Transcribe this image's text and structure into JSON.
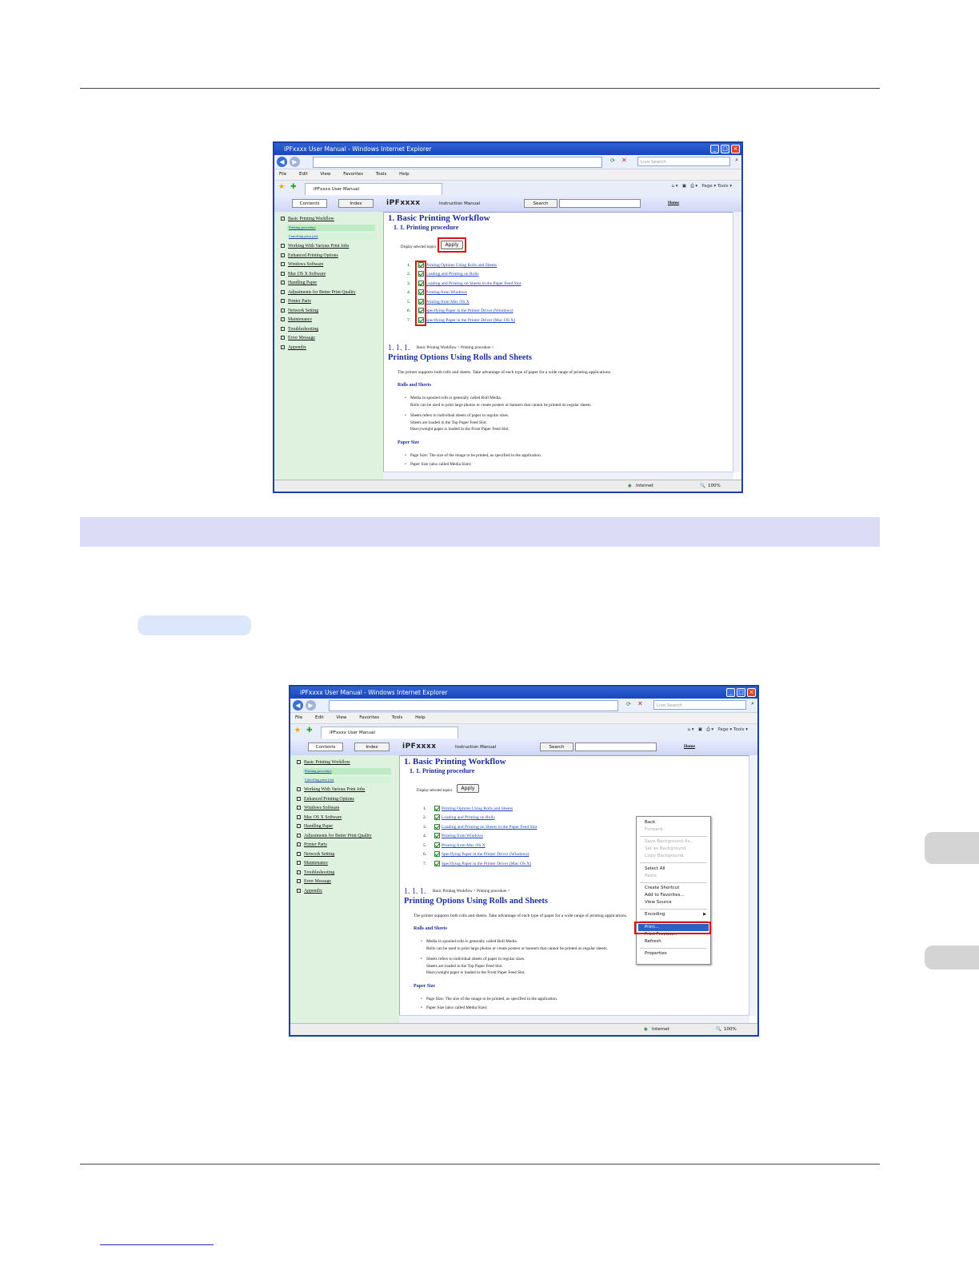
{
  "browser": {
    "title": "iPFxxxx User Manual - Windows Internet Explorer",
    "search_placeholder": "Live Search",
    "menu": [
      "File",
      "Edit",
      "View",
      "Favorites",
      "Tools",
      "Help"
    ],
    "tab_label": "iPFxxxx User Manual",
    "toolbar_right": "Page ▾  Tools ▾",
    "status_zone": "Internet",
    "zoom": "100%"
  },
  "help": {
    "tab_contents": "Contents",
    "tab_index": "Index",
    "brand": "iPFxxxx",
    "instruction_manual": "Instruction Manual",
    "search_btn": "Search",
    "home": "Home",
    "sidebar": [
      "Basic Printing Workflow",
      "Working With Various Print Jobs",
      "Enhanced Printing Options",
      "Windows Software",
      "Mac OS X Software",
      "Handling Paper",
      "Adjustments for Better Print Quality",
      "Printer Parts",
      "Network Setting",
      "Maintenance",
      "Troubleshooting",
      "Error Message",
      "Appendix"
    ],
    "sub_1": "Printing procedure",
    "sub_2": "Canceling print jobs",
    "h1": "1. Basic Printing Workflow",
    "h2": "1. 1. Printing procedure",
    "display_selected": "Display selected topics",
    "apply": "Apply",
    "topics": [
      "Printing Options Using Rolls and Sheets",
      "Loading and Printing on Rolls",
      "Loading and Printing on Sheets in the Paper Feed Slot",
      "Printing from Windows",
      "Printing from Mac OS X",
      "Specifying Paper in the Printer Driver (Windows)",
      "Specifying Paper in the Printer Driver (Mac OS X)"
    ],
    "bc_num": "1. 1. 1.",
    "bc_text": "Basic Printing Workflow > Printing procedure >",
    "h3": "Printing Options Using Rolls and Sheets",
    "intro": "The printer supports both rolls and sheets. Take advantage of each type of paper for a wide range of printing applications.",
    "rolls_heading": "Rolls and Sheets",
    "bullet1_a": "Media in spooled rolls is generally called Roll Media.",
    "bullet1_b": "Rolls can be used to print large photos or create posters or banners that cannot be printed on regular sheets.",
    "bullet2_a": "Sheets refers to individual sheets of paper in regular sizes.",
    "bullet2_b": "Sheets are loaded in the Top Paper Feed Slot.",
    "bullet2_c": "Heavyweight paper is loaded in the Front Paper Feed Slot.",
    "paper_size_heading": "Paper Size",
    "ps1": "Page Size: The size of the image to be printed, as specified in the application.",
    "ps2": "Paper Size (also called Media Size):"
  },
  "context_menu": {
    "back": "Back",
    "forward": "Forward",
    "save_bg": "Save Background As...",
    "set_bg": "Set as Background",
    "copy_bg": "Copy Background",
    "select_all": "Select All",
    "paste": "Paste",
    "create_shortcut": "Create Shortcut",
    "add_fav": "Add to Favorites...",
    "view_source": "View Source",
    "encoding": "Encoding",
    "print": "Print...",
    "print_preview": "Print Preview...",
    "refresh": "Refresh",
    "properties": "Properties"
  }
}
